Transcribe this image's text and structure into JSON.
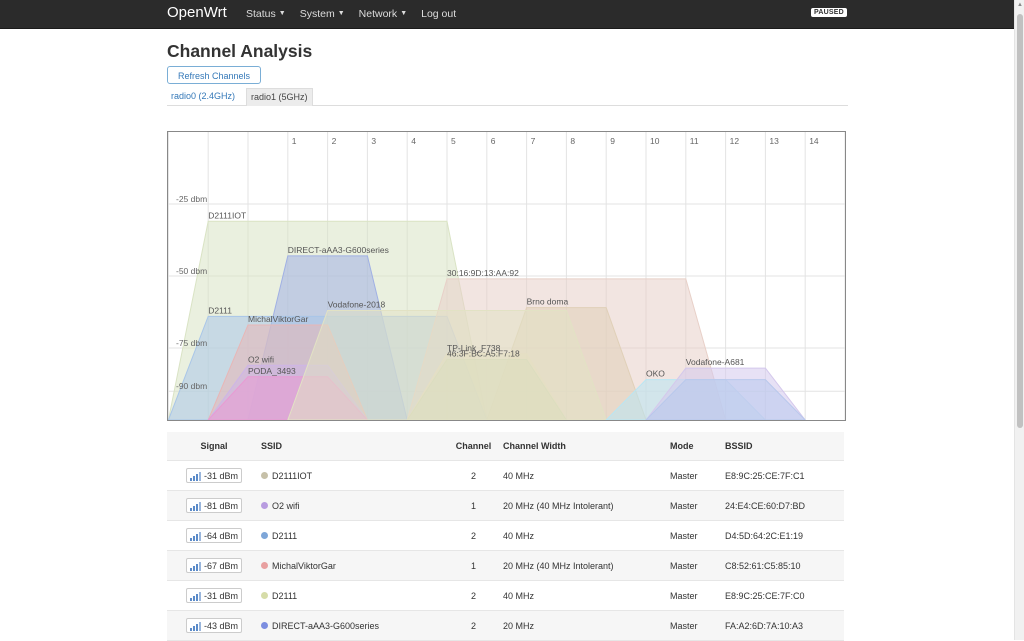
{
  "header": {
    "brand": "OpenWrt",
    "menu": [
      {
        "label": "Status",
        "dropdown": true
      },
      {
        "label": "System",
        "dropdown": true
      },
      {
        "label": "Network",
        "dropdown": true
      },
      {
        "label": "Log out",
        "dropdown": false
      }
    ],
    "paused_badge": "PAUSED"
  },
  "page": {
    "title": "Channel Analysis",
    "refresh_label": "Refresh Channels",
    "tabs": [
      {
        "label": "radio0 (2.4GHz)",
        "active": true
      },
      {
        "label": "radio1 (5GHz)",
        "active": false
      }
    ]
  },
  "chart_data": {
    "type": "area",
    "x_ticks": [
      1,
      2,
      3,
      4,
      5,
      6,
      7,
      8,
      9,
      10,
      11,
      12,
      13,
      14
    ],
    "y_ticks": [
      "-25 dbm",
      "-50 dbm",
      "-75 dbm",
      "-90 dbm"
    ],
    "y_tick_values": [
      -25,
      -50,
      -75,
      -90
    ],
    "ylim": [
      -100,
      0
    ],
    "series": [
      {
        "name": "D2111IOT",
        "center": 2,
        "width_mhz": 40,
        "signal": -31,
        "color": "#d9e3c4"
      },
      {
        "name": "DIRECT-aAA3-G600series",
        "center": 2,
        "width_mhz": 20,
        "signal": -43,
        "color": "#a0b0e4"
      },
      {
        "name": "D2111",
        "center": 2,
        "width_mhz": 40,
        "signal": -64,
        "color": "#a9c6e8"
      },
      {
        "name": "MichalViktorGar",
        "center": 1,
        "width_mhz": 20,
        "signal": -67,
        "color": "#e8b6b6"
      },
      {
        "name": "O2 wifi",
        "center": 1,
        "width_mhz": 20,
        "signal": -81,
        "color": "#cdb5e8"
      },
      {
        "name": "PODA_3493",
        "center": 1,
        "width_mhz": 20,
        "signal": -85,
        "color": "#e99ad3"
      },
      {
        "name": "30:16:9D:13:AA:92",
        "center": 8,
        "width_mhz": 40,
        "signal": -51,
        "color": "#e8d0c8"
      },
      {
        "name": "Brno doma",
        "center": 8,
        "width_mhz": 20,
        "signal": -61,
        "color": "#e0d0b8"
      },
      {
        "name": "TP-Link_F738",
        "center": 6,
        "width_mhz": 20,
        "signal": -77,
        "color": "#e8dcc0"
      },
      {
        "name": "46:3F:BC:A5:F7:18",
        "center": 6,
        "width_mhz": 20,
        "signal": -79,
        "color": "#d4d8b8"
      },
      {
        "name": "Vodafone-2018",
        "center": 5,
        "width_mhz": 40,
        "signal": -62,
        "color": "#e2e2c4"
      },
      {
        "name": "OKO",
        "center": 11,
        "width_mhz": 20,
        "signal": -86,
        "color": "#b8e6f4"
      },
      {
        "name": "Vodafone-A681",
        "center": 12,
        "width_mhz": 20,
        "signal": -82,
        "color": "#d4c8ec"
      },
      {
        "name": "",
        "center": 12,
        "width_mhz": 20,
        "signal": -86,
        "color": "#b8c8ec"
      }
    ],
    "grid": true
  },
  "table": {
    "headers": [
      "Signal",
      "SSID",
      "Channel",
      "Channel Width",
      "Mode",
      "BSSID"
    ],
    "rows": [
      {
        "signal": "-31 dBm",
        "ssid": "D2111IOT",
        "dot_color": "#c6c0a8",
        "channel": "2",
        "width": "40 MHz",
        "mode": "Master",
        "bssid": "E8:9C:25:CE:7F:C1"
      },
      {
        "signal": "-81 dBm",
        "ssid": "O2 wifi",
        "dot_color": "#b89ce0",
        "channel": "1",
        "width": "20 MHz (40 MHz Intolerant)",
        "mode": "Master",
        "bssid": "24:E4:CE:60:D7:BD"
      },
      {
        "signal": "-64 dBm",
        "ssid": "D2111",
        "dot_color": "#7ea6d8",
        "channel": "2",
        "width": "40 MHz",
        "mode": "Master",
        "bssid": "D4:5D:64:2C:E1:19"
      },
      {
        "signal": "-67 dBm",
        "ssid": "MichalViktorGar",
        "dot_color": "#e8a0a0",
        "channel": "1",
        "width": "20 MHz (40 MHz Intolerant)",
        "mode": "Master",
        "bssid": "C8:52:61:C5:85:10"
      },
      {
        "signal": "-31 dBm",
        "ssid": "D2111",
        "dot_color": "#d6dca8",
        "channel": "2",
        "width": "40 MHz",
        "mode": "Master",
        "bssid": "E8:9C:25:CE:7F:C0"
      },
      {
        "signal": "-43 dBm",
        "ssid": "DIRECT-aAA3-G600series",
        "dot_color": "#7c8ee0",
        "channel": "2",
        "width": "20 MHz",
        "mode": "Master",
        "bssid": "FA:A2:6D:7A:10:A3"
      }
    ]
  }
}
